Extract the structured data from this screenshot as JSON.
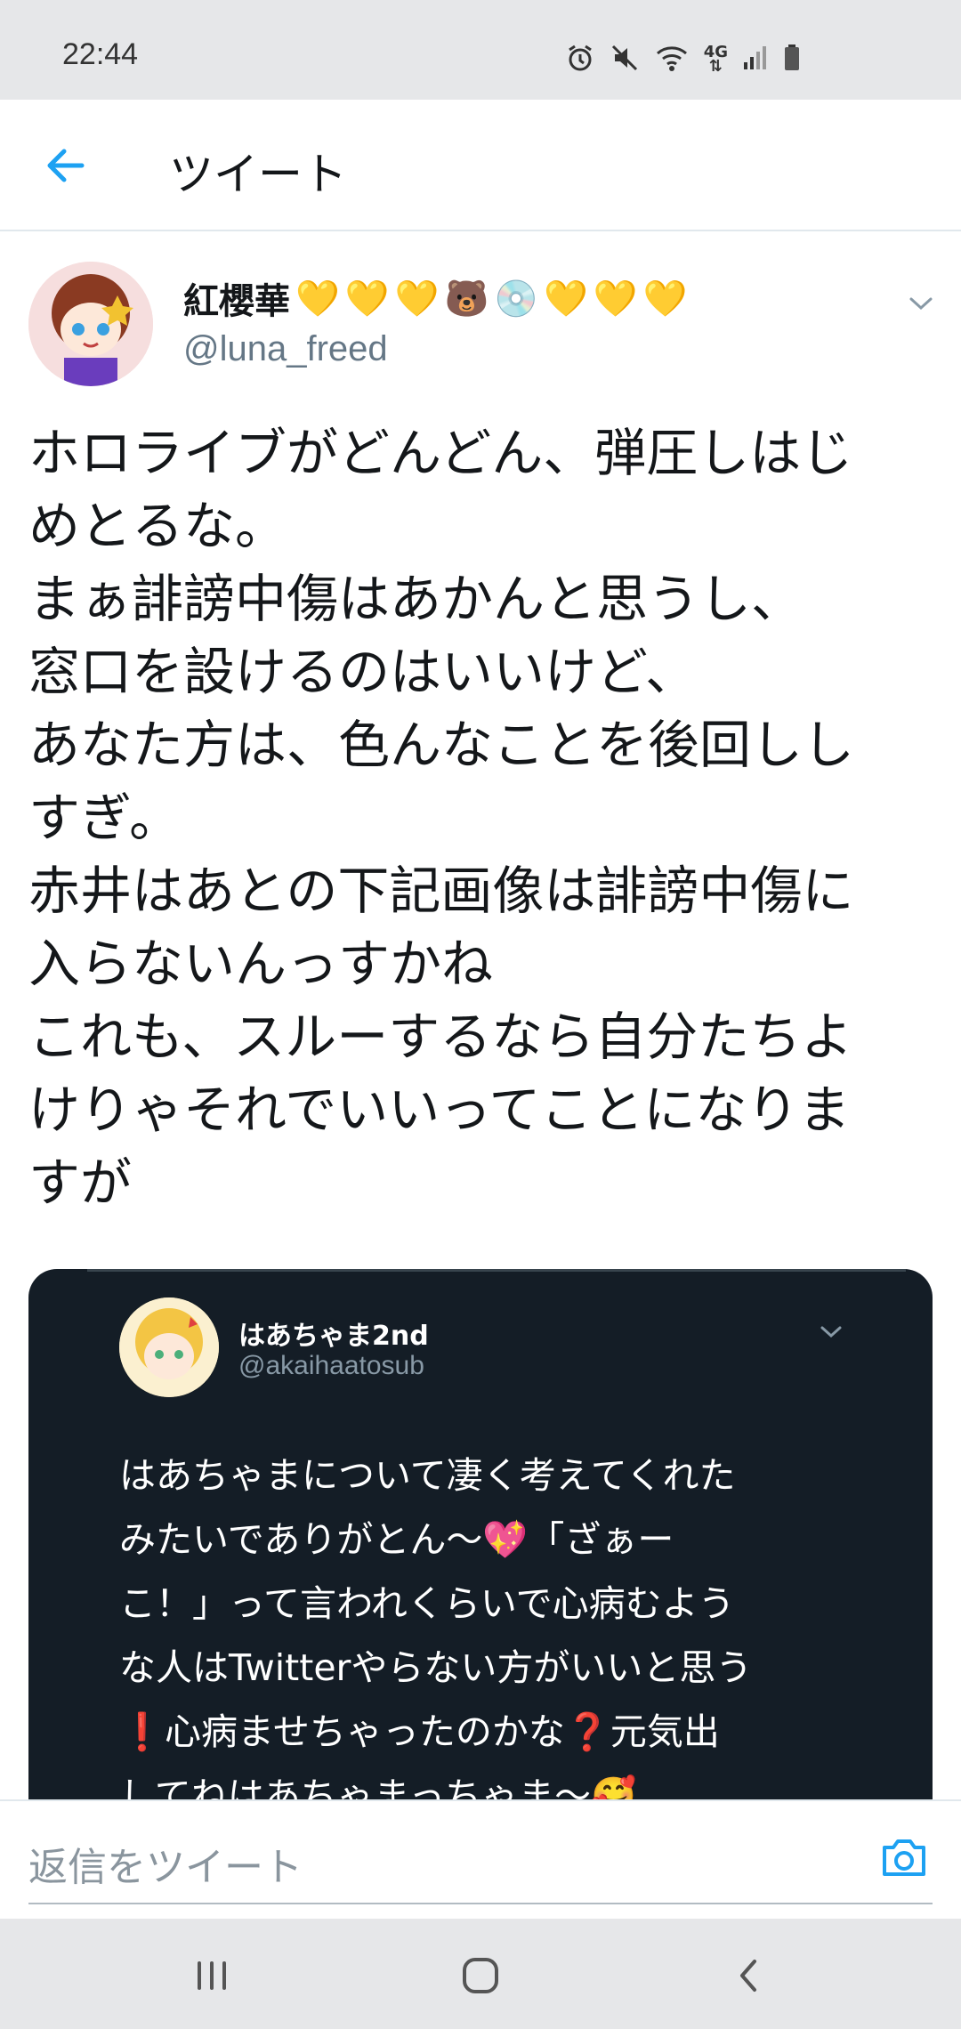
{
  "status_bar": {
    "time": "22:44",
    "icons": [
      "alarm-icon",
      "mute-icon",
      "wifi-icon",
      "4g-icon",
      "signal-icon",
      "battery-icon"
    ],
    "network_label": "4G"
  },
  "app_bar": {
    "title": "ツイート",
    "back_icon": "back-arrow-icon"
  },
  "tweet": {
    "display_name": "紅櫻華",
    "name_emoji": [
      "💛",
      "💛",
      "💛",
      "🐻",
      "💿",
      "💛",
      "💛",
      "💛"
    ],
    "handle": "@luna_freed",
    "text": "ホロライブがどんどん、弾圧しはじ\nめとるな。\nまぁ誹謗中傷はあかんと思うし、\n窓口を設けるのはいいけど、\nあなた方は、色んなことを後回しし\nすぎ。\n赤井はあとの下記画像は誹謗中傷に\n入らないんっすかね\nこれも、スルーするなら自分たちよ\nけりゃそれでいいってことになりま\nすが"
  },
  "embedded_image": {
    "name": "はあちゃま2nd",
    "handle": "@akaihaatosub",
    "text": "はあちゃまについて凄く考えてくれた\nみたいでありがとん〜💖「ざぁー\nこ！」って言われくらいで心病むよう\nな人はTwitterやらない方がいいと思う\n❗心病ませちゃったのかな❓元気出\nしてねはあちゃまっちゃま〜🥰"
  },
  "reply_bar": {
    "placeholder": "返信をツイート",
    "camera_icon": "camera-icon"
  },
  "nav_bar": {
    "buttons": [
      "recent-apps-icon",
      "home-icon",
      "back-icon"
    ]
  },
  "colors": {
    "accent": "#1da1f2",
    "status_bg": "#e6e7e9",
    "embed_bg": "#141d26"
  }
}
